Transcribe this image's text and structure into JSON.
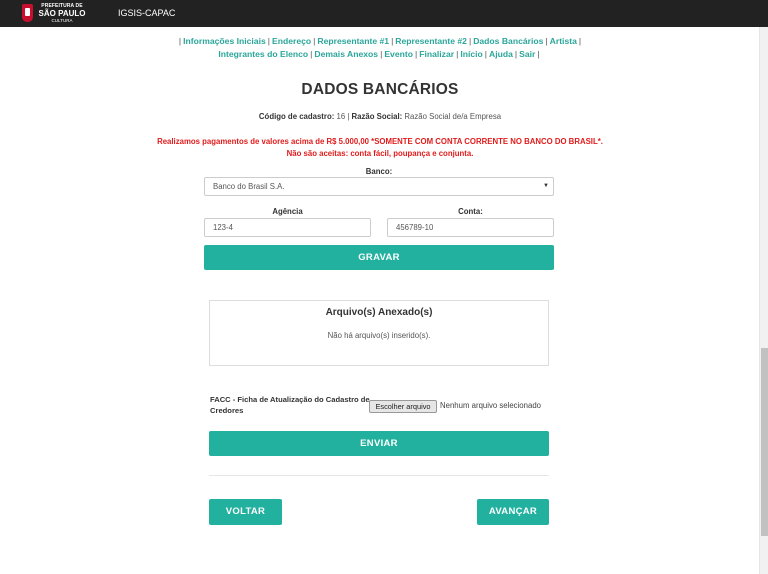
{
  "header": {
    "logo_line1": "PREFEITURA DE",
    "logo_line2": "SÃO PAULO",
    "logo_line3": "CULTURA",
    "app_name": "IGSIS-CAPAC"
  },
  "nav": {
    "items": [
      "Informações Iniciais",
      "Endereço",
      "Representante #1",
      "Representante #2",
      "Dados Bancários",
      "Artista",
      "Integrantes do Elenco",
      "Demais Anexos",
      "Evento",
      "Finalizar",
      "Início",
      "Ajuda",
      "Sair"
    ],
    "separator": "|"
  },
  "page": {
    "title": "DADOS BANCÁRIOS",
    "code_label": "Código de cadastro:",
    "code_value": "16",
    "company_label": "Razão Social:",
    "company_value": "Razão Social de/a Empresa",
    "warning_line1": "Realizamos pagamentos de valores acima de R$ 5.000,00 *SOMENTE COM CONTA CORRENTE NO BANCO DO BRASIL*.",
    "warning_line2": "Não são aceitas: conta fácil, poupança e conjunta."
  },
  "form": {
    "bank_label": "Banco:",
    "bank_value": "Banco do Brasil S.A.",
    "agency_label": "Agência",
    "agency_value": "123-4",
    "account_label": "Conta:",
    "account_value": "456789-10",
    "save_button": "GRAVAR"
  },
  "attachments": {
    "title": "Arquivo(s) Anexado(s)",
    "empty_text": "Não há arquivo(s) inserido(s).",
    "facc_label": "FACC - Ficha de Atualização do Cadastro de Credores",
    "choose_file_button": "Escolher arquivo",
    "no_file_text": "Nenhum arquivo selecionado",
    "send_button": "ENVIAR"
  },
  "footer_nav": {
    "back_button": "VOLTAR",
    "next_button": "AVANÇAR"
  },
  "colors": {
    "accent": "#22b19f",
    "link": "#2aa69a",
    "warning": "#e11b1b",
    "topbar": "#222222"
  }
}
